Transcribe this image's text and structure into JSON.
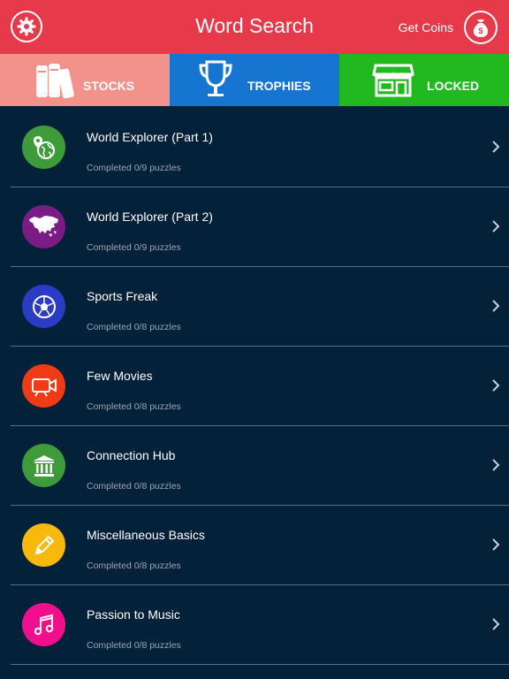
{
  "header": {
    "title": "Word Search",
    "coins_label": "Get Coins",
    "settings_icon": "gear-icon",
    "coins_icon": "money-bag-icon",
    "bg_color": "#e63a4a"
  },
  "tabs": [
    {
      "label": "STOCKS",
      "icon": "books-icon",
      "color": "#f2928b"
    },
    {
      "label": "TROPHIES",
      "icon": "trophy-icon",
      "color": "#1675d1"
    },
    {
      "label": "LOCKED",
      "icon": "store-icon",
      "color": "#21b820"
    }
  ],
  "categories": [
    {
      "name": "World Explorer (Part 1)",
      "progress": "Completed 0/9 puzzles",
      "icon": "globe-pin-icon",
      "color": "#3e9b3a"
    },
    {
      "name": "World Explorer (Part 2)",
      "progress": "Completed 0/9 puzzles",
      "icon": "asia-map-icon",
      "color": "#7a1b86"
    },
    {
      "name": "Sports Freak",
      "progress": "Completed 0/8 puzzles",
      "icon": "soccer-ball-icon",
      "color": "#2b3cc4"
    },
    {
      "name": "Few Movies",
      "progress": "Completed 0/8 puzzles",
      "icon": "video-camera-icon",
      "color": "#f03c16"
    },
    {
      "name": "Connection Hub",
      "progress": "Completed 0/8 puzzles",
      "icon": "bank-icon",
      "color": "#3e9b3a"
    },
    {
      "name": "Miscellaneous Basics",
      "progress": "Completed 0/8 puzzles",
      "icon": "pencil-icon",
      "color": "#f8b80c"
    },
    {
      "name": "Passion to Music",
      "progress": "Completed 0/8 puzzles",
      "icon": "music-note-icon",
      "color": "#f20f8e"
    }
  ],
  "background_color": "#04213a"
}
